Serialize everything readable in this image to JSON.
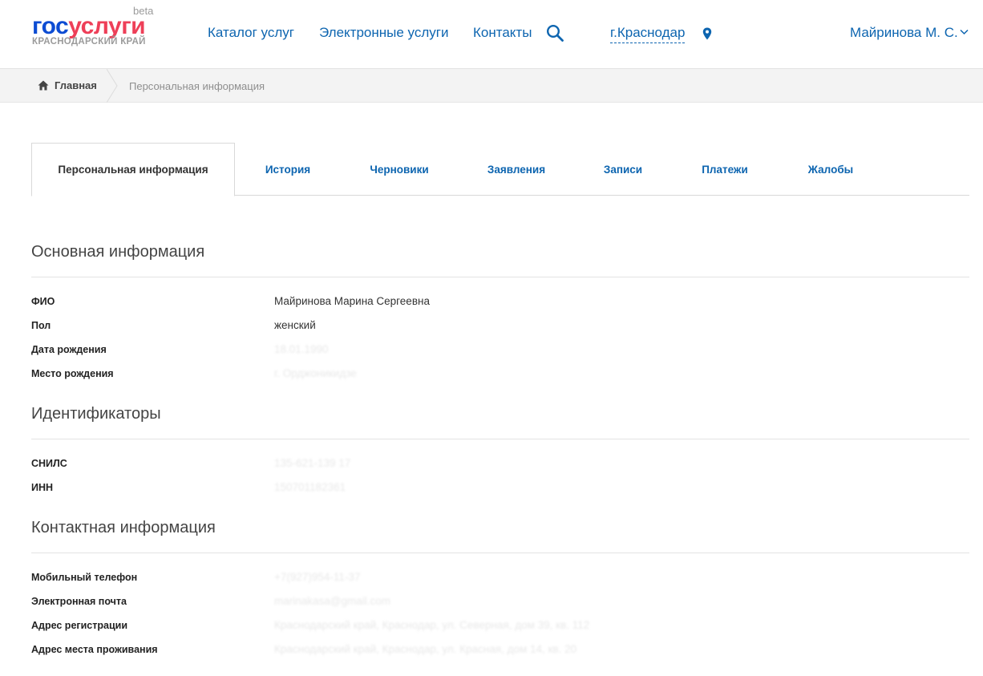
{
  "header": {
    "logo": {
      "gos": "гос",
      "uslugi": "услуги",
      "beta": "beta",
      "region": "КРАСНОДАРСКИЙ КРАЙ"
    },
    "nav": [
      {
        "label": "Каталог услуг"
      },
      {
        "label": "Электронные услуги"
      },
      {
        "label": "Контакты"
      }
    ],
    "search_icon": "search-icon",
    "city": "г.Краснодар",
    "location_icon": "map-pin-icon",
    "user": "Майринова М. С."
  },
  "breadcrumb": {
    "home": "Главная",
    "current": "Персональная информация"
  },
  "tabs": [
    {
      "label": "Персональная информация",
      "active": true
    },
    {
      "label": "История"
    },
    {
      "label": "Черновики"
    },
    {
      "label": "Заявления"
    },
    {
      "label": "Записи"
    },
    {
      "label": "Платежи"
    },
    {
      "label": "Жалобы"
    }
  ],
  "sections": {
    "basic": {
      "title": "Основная информация",
      "rows": [
        {
          "label": "ФИО",
          "value": "Майринова Марина Сергеевна"
        },
        {
          "label": "Пол",
          "value": "женский"
        },
        {
          "label": "Дата рождения",
          "value": "18.01.1990"
        },
        {
          "label": "Место рождения",
          "value": "г. Орджоникидзе"
        }
      ]
    },
    "ids": {
      "title": "Идентификаторы",
      "rows": [
        {
          "label": "СНИЛС",
          "value": "135-621-139 17"
        },
        {
          "label": "ИНН",
          "value": "150701182361"
        }
      ]
    },
    "contacts": {
      "title": "Контактная информация",
      "rows": [
        {
          "label": "Мобильный телефон",
          "value": "+7(927)954-11-37"
        },
        {
          "label": "Электронная почта",
          "value": "marinakasa@gmail.com"
        },
        {
          "label": "Адрес регистрации",
          "value": "Краснодарский край, Краснодар, ул. Северная, дом 39, кв. 112"
        },
        {
          "label": "Адрес места проживания",
          "value": "Краснодарский край, Краснодар, ул. Красная, дом 14, кв. 20"
        }
      ]
    }
  },
  "colors": {
    "link": "#0d65b0",
    "logo_blue": "#0d4cd3",
    "logo_red": "#ee3f58"
  }
}
